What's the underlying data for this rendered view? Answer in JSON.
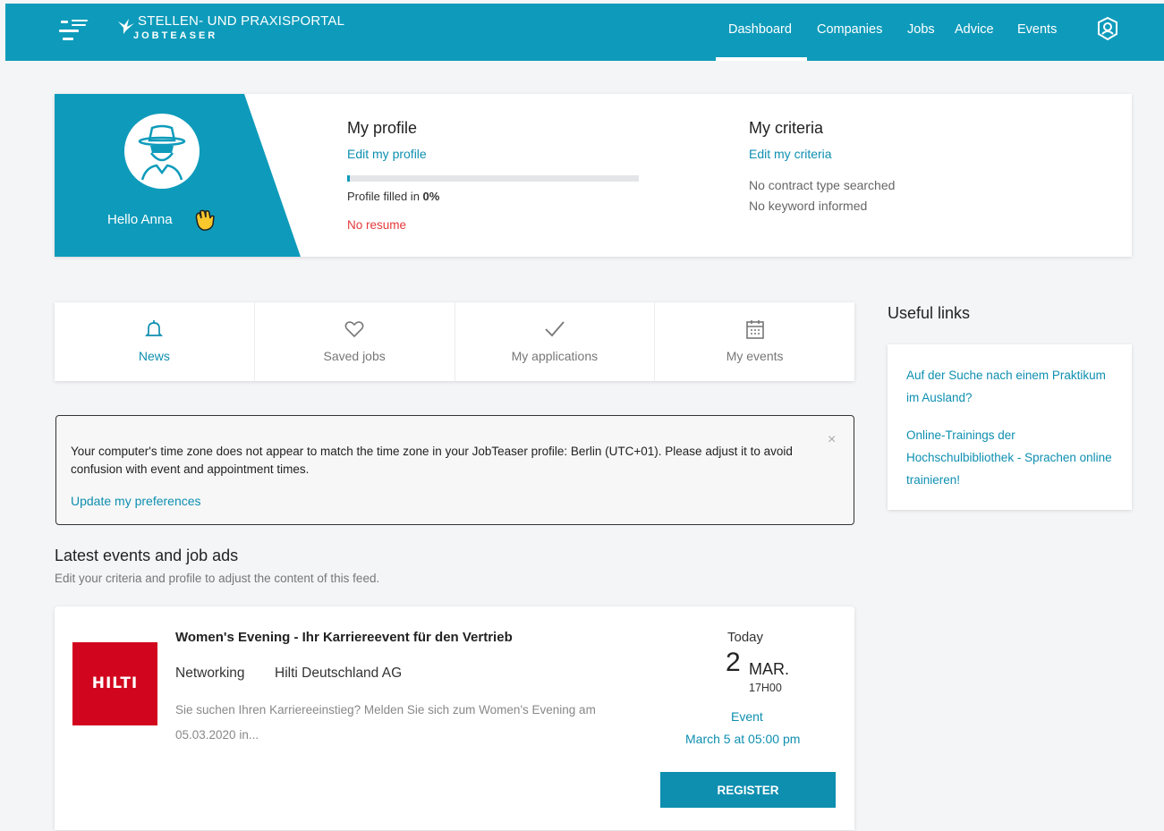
{
  "colors": {
    "primary": "#0e9bbb",
    "link": "#0e8fb0",
    "alert": "#e5383b",
    "hilti": "#d2051e"
  },
  "header": {
    "brand_title": "STELLEN- UND PRAXISPORTAL",
    "brand_sub": "JOBTEASER",
    "nav": [
      {
        "label": "Dashboard",
        "active": true
      },
      {
        "label": "Companies"
      },
      {
        "label": "Jobs"
      },
      {
        "label": "Advice"
      },
      {
        "label": "Events"
      }
    ],
    "account_icon": "user-circle-icon"
  },
  "profile": {
    "greeting": "Hello Anna",
    "greeting_icon": "waving-hand-icon",
    "my_profile_title": "My profile",
    "edit_profile": "Edit my profile",
    "progress_percent": 0,
    "filled_prefix": "Profile filled in ",
    "filled_value": "0%",
    "no_resume": "No resume",
    "my_criteria_title": "My criteria",
    "edit_criteria": "Edit my criteria",
    "criteria_lines": [
      "No contract type searched",
      "No keyword informed"
    ]
  },
  "tabs": [
    {
      "label": "News",
      "icon": "bell-icon",
      "active": true
    },
    {
      "label": "Saved jobs",
      "icon": "heart-icon"
    },
    {
      "label": "My applications",
      "icon": "checkmark-icon"
    },
    {
      "label": "My events",
      "icon": "calendar-icon"
    }
  ],
  "useful_links": {
    "title": "Useful links",
    "links": [
      "Auf der Suche nach einem Praktikum im Ausland?",
      "Online-Trainings der Hochschulbibliothek - Sprachen online trainieren!"
    ]
  },
  "alert": {
    "message": "Your computer's time zone does not appear to match the time zone in your JobTeaser profile: Berlin (UTC+01). Please adjust it to avoid confusion with event and appointment times.",
    "link": "Update my preferences",
    "close": "×"
  },
  "feed": {
    "title": "Latest events and job ads",
    "subtitle": "Edit your criteria and profile to adjust the content of this feed."
  },
  "event": {
    "logo_text": "HILTI",
    "title": "Women's Evening - Ihr Karriereevent für den Vertrieb",
    "type": "Networking",
    "company": "Hilti Deutschland AG",
    "description": "Sie suchen Ihren Karriereeinstieg? Melden Sie sich zum Women's Evening am 05.03.2020 in...",
    "posted": "Today",
    "day": "2",
    "month": "MAR.",
    "time": "17H00",
    "label": "Event",
    "when": "March 5 at 05:00 pm",
    "register": "REGISTER"
  }
}
